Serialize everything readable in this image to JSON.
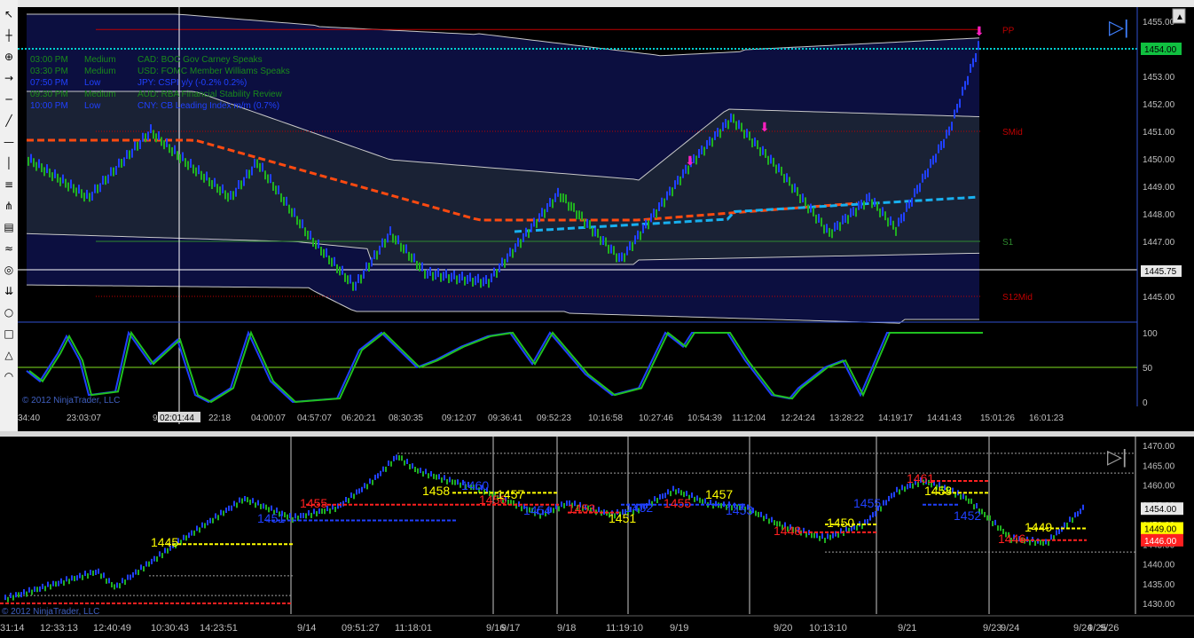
{
  "toolbar": {
    "icons": [
      "pointer-icon",
      "crosshair-icon",
      "zoom-icon",
      "arrow-icon",
      "line-icon",
      "ray-icon",
      "hline-icon",
      "vline-icon",
      "fib-icon",
      "pitchfork-icon",
      "regression-icon",
      "andrews-icon",
      "gann-icon",
      "channel-icon",
      "ellipse-icon",
      "rectangle-icon",
      "triangle-icon",
      "arc-icon"
    ]
  },
  "main_chart": {
    "price_axis": {
      "ticks": [
        "1455.00",
        "1454.00",
        "1453.00",
        "1452.00",
        "1451.00",
        "1450.00",
        "1449.00",
        "1448.00",
        "1447.00",
        "1446.00",
        "1445.00"
      ],
      "current_price": "1454.00",
      "marker_price": "1445.75"
    },
    "levels": [
      {
        "label": "PP",
        "price": 1454.7,
        "color": "#c00000"
      },
      {
        "label": "SMid",
        "price": 1451.0,
        "color": "#c00000"
      },
      {
        "label": "S1",
        "price": 1447.0,
        "color": "#2e8b2e"
      },
      {
        "label": "S12Mid",
        "price": 1445.0,
        "color": "#c00000"
      }
    ],
    "news": [
      {
        "time": "03:00 PM",
        "impact": "Medium",
        "text": "CAD: BOC Gov Carney Speaks"
      },
      {
        "time": "03:30 PM",
        "impact": "Medium",
        "text": "USD: FOMC Member Williams Speaks"
      },
      {
        "time": "07:50 PM",
        "impact": "Low",
        "text": "JPY: CSPI y/y (-0.2% 0.2%)"
      },
      {
        "time": "09:30 PM",
        "impact": "Medium",
        "text": "AUD: RBA Financial Stability Review"
      },
      {
        "time": "10:00 PM",
        "impact": "Low",
        "text": "CNY: CB Leading Index m/m (0.7%)"
      }
    ],
    "copyright": "© 2012 NinjaTrader, LLC",
    "time_axis": [
      "34:40",
      "23:03:07",
      "9/2",
      "02:01:44",
      "22:18",
      "04:00:07",
      "04:57:07",
      "06:20:21",
      "08:30:35",
      "09:12:07",
      "09:36:41",
      "09:52:23",
      "10:16:58",
      "10:27:46",
      "10:54:39",
      "11:12:04",
      "12:24:24",
      "13:28:22",
      "14:19:17",
      "14:41:43",
      "15:01:26",
      "16:01:23"
    ],
    "osc_ticks": [
      "100",
      "50",
      "0"
    ]
  },
  "lower_chart": {
    "price_axis": {
      "ticks": [
        "1470.00",
        "1465.00",
        "1460.00",
        "1455.00",
        "1450.00",
        "1445.00",
        "1440.00",
        "1435.00",
        "1430.00"
      ],
      "current_price": "1454.00",
      "yellow_price": "1449.00",
      "red_price": "1446.00"
    },
    "labels": [
      {
        "text": "1445",
        "color": "#ffff00"
      },
      {
        "text": "1451",
        "color": "#2040ff"
      },
      {
        "text": "1455",
        "color": "#ff2020"
      },
      {
        "text": "1458",
        "color": "#ffff00"
      },
      {
        "text": "1460",
        "color": "#2040ff"
      },
      {
        "text": "1456",
        "color": "#ff2020"
      },
      {
        "text": "1457",
        "color": "#ffff00"
      },
      {
        "text": "1454",
        "color": "#2040ff"
      },
      {
        "text": "1453",
        "color": "#ff2020"
      },
      {
        "text": "1451",
        "color": "#ffff00"
      },
      {
        "text": "1452",
        "color": "#2040ff"
      },
      {
        "text": "1455",
        "color": "#ff2020"
      },
      {
        "text": "1457",
        "color": "#ffff00"
      },
      {
        "text": "1453",
        "color": "#2040ff"
      },
      {
        "text": "1448",
        "color": "#ff2020"
      },
      {
        "text": "1450",
        "color": "#ffff00"
      },
      {
        "text": "1455",
        "color": "#2040ff"
      },
      {
        "text": "1461",
        "color": "#ff2020"
      },
      {
        "text": "1458",
        "color": "#ffff00"
      },
      {
        "text": "1452",
        "color": "#2040ff"
      },
      {
        "text": "1446",
        "color": "#ff2020"
      },
      {
        "text": "1449",
        "color": "#ffff00"
      }
    ],
    "copyright": "© 2012 NinjaTrader, LLC",
    "time_axis": [
      "31:14",
      "12:33:13",
      "12:40:49",
      "10:30:43",
      "14:23:51",
      "9/14",
      "09:51:27",
      "11:18:01",
      "9/16",
      "9/17",
      "9/18",
      "11:19:10",
      "9/19",
      "9/20",
      "10:13:10",
      "9/21",
      "9/23",
      "9/24",
      "9/24",
      "9/25",
      "9/26"
    ]
  }
}
